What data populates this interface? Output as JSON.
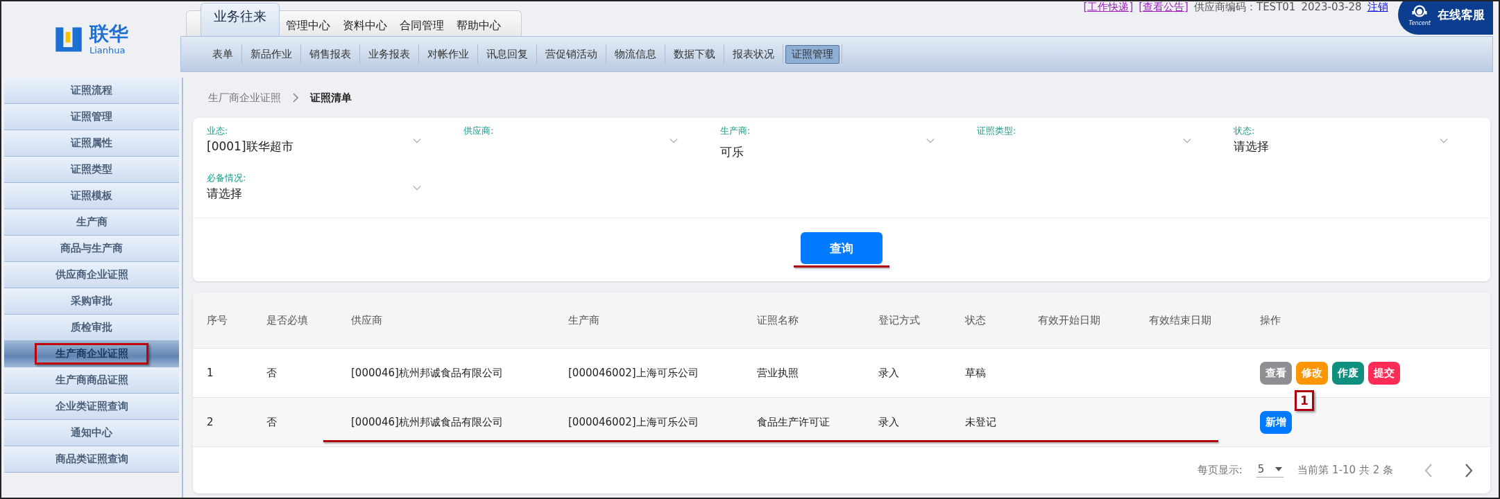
{
  "logo": {
    "name": "联华",
    "latin": "Lianhua"
  },
  "main_tabs": [
    {
      "label": "业务往来",
      "selected": true
    },
    {
      "label": "管理中心",
      "selected": false
    },
    {
      "label": "资料中心",
      "selected": false
    },
    {
      "label": "合同管理",
      "selected": false
    },
    {
      "label": "帮助中心",
      "selected": false
    }
  ],
  "header_links": {
    "quick": "[工作快递]",
    "notice": "[查看公告]",
    "supplier_code": "供应商编码：TEST01",
    "date": "2023-03-28",
    "logout": "注销"
  },
  "service_badge": {
    "label": "在线客服",
    "brand": "Tencent"
  },
  "sub_nav": [
    {
      "label": "表单",
      "selected": false
    },
    {
      "label": "新品作业",
      "selected": false
    },
    {
      "label": "销售报表",
      "selected": false
    },
    {
      "label": "业务报表",
      "selected": false
    },
    {
      "label": "对帐作业",
      "selected": false
    },
    {
      "label": "讯息回复",
      "selected": false
    },
    {
      "label": "营促销活动",
      "selected": false
    },
    {
      "label": "物流信息",
      "selected": false
    },
    {
      "label": "数据下载",
      "selected": false
    },
    {
      "label": "报表状况",
      "selected": false
    },
    {
      "label": "证照管理",
      "selected": true
    }
  ],
  "sidebar": {
    "items": [
      {
        "label": "证照流程",
        "selected": false,
        "annotated": false
      },
      {
        "label": "证照管理",
        "selected": false,
        "annotated": false
      },
      {
        "label": "证照属性",
        "selected": false,
        "annotated": false
      },
      {
        "label": "证照类型",
        "selected": false,
        "annotated": false
      },
      {
        "label": "证照模板",
        "selected": false,
        "annotated": false
      },
      {
        "label": "生产商",
        "selected": false,
        "annotated": false
      },
      {
        "label": "商品与生产商",
        "selected": false,
        "annotated": false
      },
      {
        "label": "供应商企业证照",
        "selected": false,
        "annotated": false
      },
      {
        "label": "采购审批",
        "selected": false,
        "annotated": false
      },
      {
        "label": "质检审批",
        "selected": false,
        "annotated": false
      },
      {
        "label": "生产商企业证照",
        "selected": true,
        "annotated": true
      },
      {
        "label": "生产商商品证照",
        "selected": false,
        "annotated": false
      },
      {
        "label": "企业类证照查询",
        "selected": false,
        "annotated": false
      },
      {
        "label": "通知中心",
        "selected": false,
        "annotated": false
      },
      {
        "label": "商品类证照查询",
        "selected": false,
        "annotated": false
      }
    ]
  },
  "breadcrumb": [
    "生厂商企业证照",
    "证照清单"
  ],
  "filters": [
    {
      "label": "业态:",
      "value": "[0001]联华超市"
    },
    {
      "label": "供应商:"
    },
    {
      "label": "生产商:",
      "value": "可乐"
    },
    {
      "label": "证照类型:"
    },
    {
      "label": "状态:",
      "value": "请选择"
    },
    {
      "label": "必备情况:",
      "value": "请选择"
    }
  ],
  "search_button": {
    "label": "查询",
    "annotated": true
  },
  "table": {
    "columns": [
      "序号",
      "是否必填",
      "供应商",
      "生产商",
      "证照名称",
      "登记方式",
      "状态",
      "有效开始日期",
      "有效结束日期",
      "操作"
    ],
    "rows": [
      {
        "cells": [
          "1",
          "否",
          "[000046]杭州邦诚食品有限公司",
          "[000046002]上海可乐公司",
          "营业执照",
          "录入",
          "草稿",
          "",
          ""
        ],
        "annotated": false,
        "actions": [
          {
            "label": "查看",
            "kind": "view"
          },
          {
            "label": "修改",
            "kind": "edit"
          },
          {
            "label": "作废",
            "kind": "void"
          },
          {
            "label": "提交",
            "kind": "submit"
          }
        ]
      },
      {
        "cells": [
          "2",
          "否",
          "[000046]杭州邦诚食品有限公司",
          "[000046002]上海可乐公司",
          "食品生产许可证",
          "录入",
          "未登记",
          "",
          ""
        ],
        "annotated": true,
        "callout": "1",
        "actions": [
          {
            "label": "新增",
            "kind": "add"
          }
        ]
      }
    ]
  },
  "pagination": {
    "page_size_label": "每页显示:",
    "page_size": "5",
    "summary": "当前第 1-10 共 2 条"
  }
}
